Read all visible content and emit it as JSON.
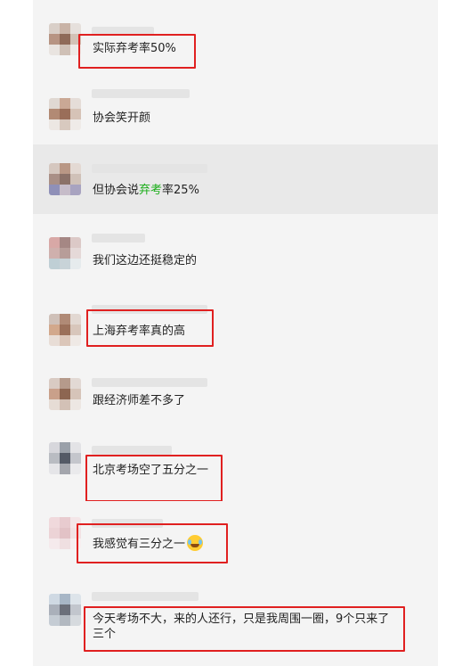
{
  "nav": {
    "back_icon": "chevron-left-icon"
  },
  "messages": [
    {
      "segments": [
        "实际弃考率50%"
      ]
    },
    {
      "segments": [
        "协会笑开颜"
      ]
    },
    {
      "segments": [
        "但协会说",
        "弃考",
        "率25%"
      ]
    },
    {
      "segments": [
        "我们这边还挺稳定的"
      ]
    },
    {
      "segments": [
        "上海弃考率真的高"
      ]
    },
    {
      "segments": [
        "跟经济师差不多了"
      ]
    },
    {
      "segments": [
        "北京考场空了五分之一"
      ]
    },
    {
      "segments": [
        "我感觉有三分之一"
      ],
      "emoji": "laughing-crying-emoji"
    },
    {
      "segments": [
        "今天考场不大，来的人还行，只是我周围一圈，9个只来了三个"
      ]
    }
  ],
  "colors": {
    "highlight": "#1aad19",
    "annotation_box": "#e02020",
    "background": "#f4f4f4",
    "selected_row": "#e9e9e9"
  }
}
